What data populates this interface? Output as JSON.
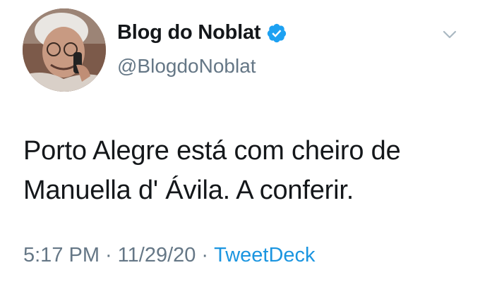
{
  "tweet": {
    "display_name": "Blog do Noblat",
    "handle": "@BlogdoNoblat",
    "verified": true,
    "text": "Porto Alegre está com cheiro de Manuella d' Ávila. A conferir.",
    "time": "5:17 PM",
    "separator": "·",
    "date": "11/29/20",
    "source": "TweetDeck"
  },
  "icons": {
    "verified": "verified-badge-icon",
    "menu": "chevron-down-icon"
  },
  "colors": {
    "text": "#14171a",
    "secondary": "#657786",
    "link": "#1b95e0",
    "verified": "#1da1f2",
    "caret": "#aab8c2"
  }
}
